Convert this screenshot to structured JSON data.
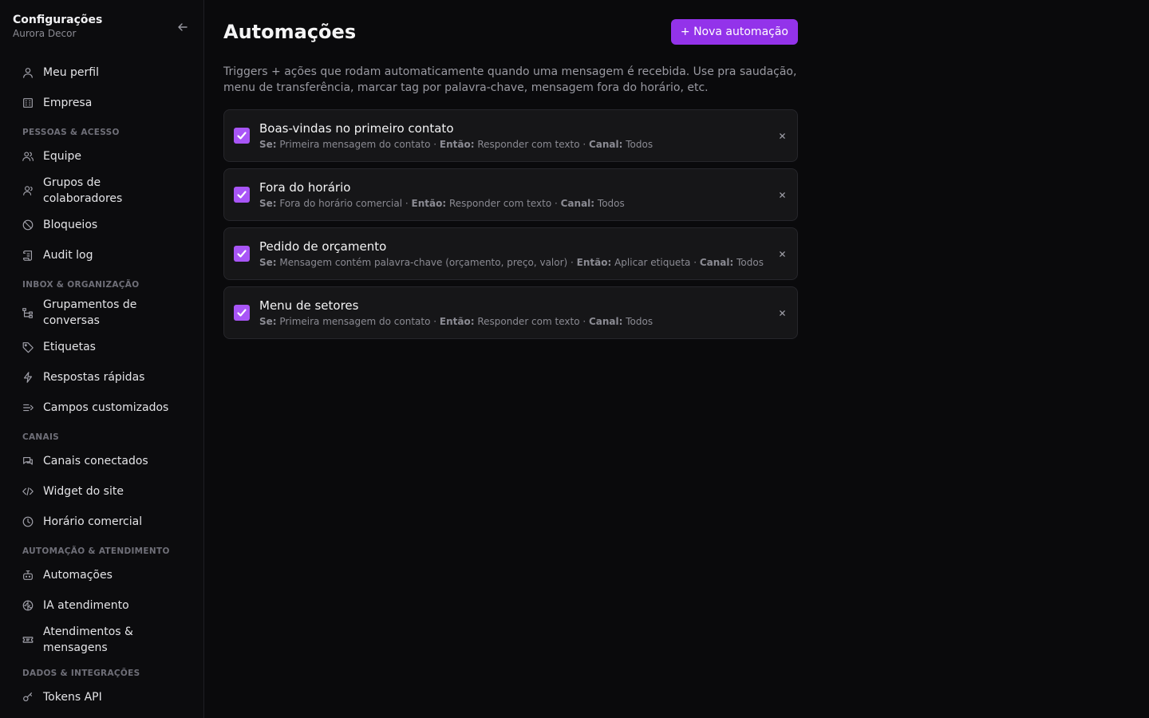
{
  "sidebar": {
    "title": "Configurações",
    "subtitle": "Aurora Decor",
    "top_items": [
      {
        "label": "Meu perfil",
        "icon": "user-icon"
      },
      {
        "label": "Empresa",
        "icon": "building-icon"
      }
    ],
    "sections": [
      {
        "title": "PESSOAS & ACESSO",
        "items": [
          {
            "label": "Equipe",
            "icon": "users-icon"
          },
          {
            "label": "Grupos de colaboradores",
            "icon": "user-group-icon"
          },
          {
            "label": "Bloqueios",
            "icon": "ban-icon"
          },
          {
            "label": "Audit log",
            "icon": "scroll-icon"
          }
        ]
      },
      {
        "title": "INBOX & ORGANIZAÇÃO",
        "items": [
          {
            "label": "Grupamentos de conversas",
            "icon": "tree-icon"
          },
          {
            "label": "Etiquetas",
            "icon": "tag-icon"
          },
          {
            "label": "Respostas rápidas",
            "icon": "zap-icon"
          },
          {
            "label": "Campos customizados",
            "icon": "list-arrow-icon"
          }
        ]
      },
      {
        "title": "CANAIS",
        "items": [
          {
            "label": "Canais conectados",
            "icon": "chat-icon"
          },
          {
            "label": "Widget do site",
            "icon": "code-icon"
          },
          {
            "label": "Horário comercial",
            "icon": "clock-icon"
          }
        ]
      },
      {
        "title": "AUTOMAÇÃO & ATENDIMENTO",
        "items": [
          {
            "label": "Automações",
            "icon": "bot-icon"
          },
          {
            "label": "IA atendimento",
            "icon": "brain-icon"
          },
          {
            "label": "Atendimentos & mensagens",
            "icon": "ticket-icon"
          }
        ]
      },
      {
        "title": "DADOS & INTEGRAÇÕES",
        "items": [
          {
            "label": "Tokens API",
            "icon": "key-icon"
          }
        ]
      }
    ]
  },
  "main": {
    "title": "Automações",
    "new_button": "+ Nova automação",
    "description": "Triggers + ações que rodam automaticamente quando uma mensagem é recebida. Use pra saudação, menu de transferência, marcar tag por palavra-chave, mensagem fora do horário, etc.",
    "labels": {
      "if": "Se:",
      "then": "Então:",
      "channel": "Canal:",
      "sep": "·"
    },
    "automations": [
      {
        "title": "Boas-vindas no primeiro contato",
        "enabled": true,
        "trigger": "Primeira mensagem do contato",
        "action": "Responder com texto",
        "channel": "Todos"
      },
      {
        "title": "Fora do horário",
        "enabled": true,
        "trigger": "Fora do horário comercial",
        "action": "Responder com texto",
        "channel": "Todos"
      },
      {
        "title": "Pedido de orçamento",
        "enabled": true,
        "trigger": "Mensagem contém palavra-chave (orçamento, preço, valor)",
        "action": "Aplicar etiqueta",
        "channel": "Todos"
      },
      {
        "title": "Menu de setores",
        "enabled": true,
        "trigger": "Primeira mensagem do contato",
        "action": "Responder com texto",
        "channel": "Todos"
      }
    ]
  },
  "colors": {
    "accent": "#9333ea",
    "checkbox": "#a855f7",
    "background": "#0a0a0c"
  }
}
